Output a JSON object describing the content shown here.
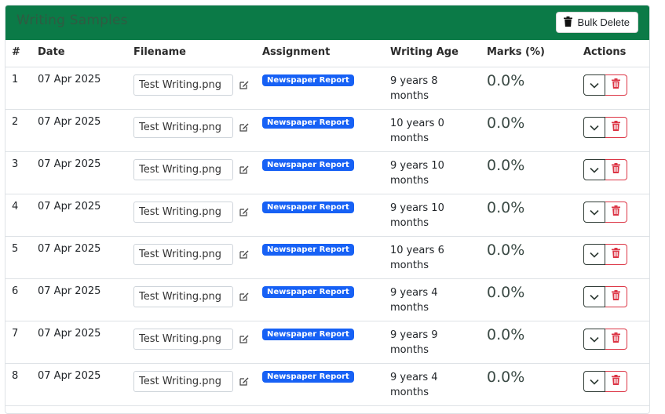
{
  "header": {
    "title": "Writing Samples",
    "bulk_delete_label": "Bulk Delete"
  },
  "columns": [
    "#",
    "Date",
    "Filename",
    "Assignment",
    "Writing Age",
    "Marks (%)",
    "Actions"
  ],
  "rows": [
    {
      "num": "1",
      "date": "07 Apr 2025",
      "filename": "Test Writing.png",
      "assignment": "Newspaper Report",
      "age": "9 years 8 months",
      "marks": "0.0%"
    },
    {
      "num": "2",
      "date": "07 Apr 2025",
      "filename": "Test Writing.png",
      "assignment": "Newspaper Report",
      "age": "10 years 0 months",
      "marks": "0.0%"
    },
    {
      "num": "3",
      "date": "07 Apr 2025",
      "filename": "Test Writing.png",
      "assignment": "Newspaper Report",
      "age": "9 years 10 months",
      "marks": "0.0%"
    },
    {
      "num": "4",
      "date": "07 Apr 2025",
      "filename": "Test Writing.png",
      "assignment": "Newspaper Report",
      "age": "9 years 10 months",
      "marks": "0.0%"
    },
    {
      "num": "5",
      "date": "07 Apr 2025",
      "filename": "Test Writing.png",
      "assignment": "Newspaper Report",
      "age": "10 years 6 months",
      "marks": "0.0%"
    },
    {
      "num": "6",
      "date": "07 Apr 2025",
      "filename": "Test Writing.png",
      "assignment": "Newspaper Report",
      "age": "9 years 4 months",
      "marks": "0.0%"
    },
    {
      "num": "7",
      "date": "07 Apr 2025",
      "filename": "Test Writing.png",
      "assignment": "Newspaper Report",
      "age": "9 years 9 months",
      "marks": "0.0%"
    },
    {
      "num": "8",
      "date": "07 Apr 2025",
      "filename": "Test Writing.png",
      "assignment": "Newspaper Report",
      "age": "9 years 4 months",
      "marks": "0.0%"
    }
  ],
  "icons": {
    "bulk_delete": "trash-icon",
    "edit": "edit-icon",
    "expand": "chevron-down-icon",
    "delete": "trash-icon"
  },
  "colors": {
    "header_bg": "#0b7a47",
    "badge_bg": "#1761f5",
    "danger": "#dc3545"
  }
}
